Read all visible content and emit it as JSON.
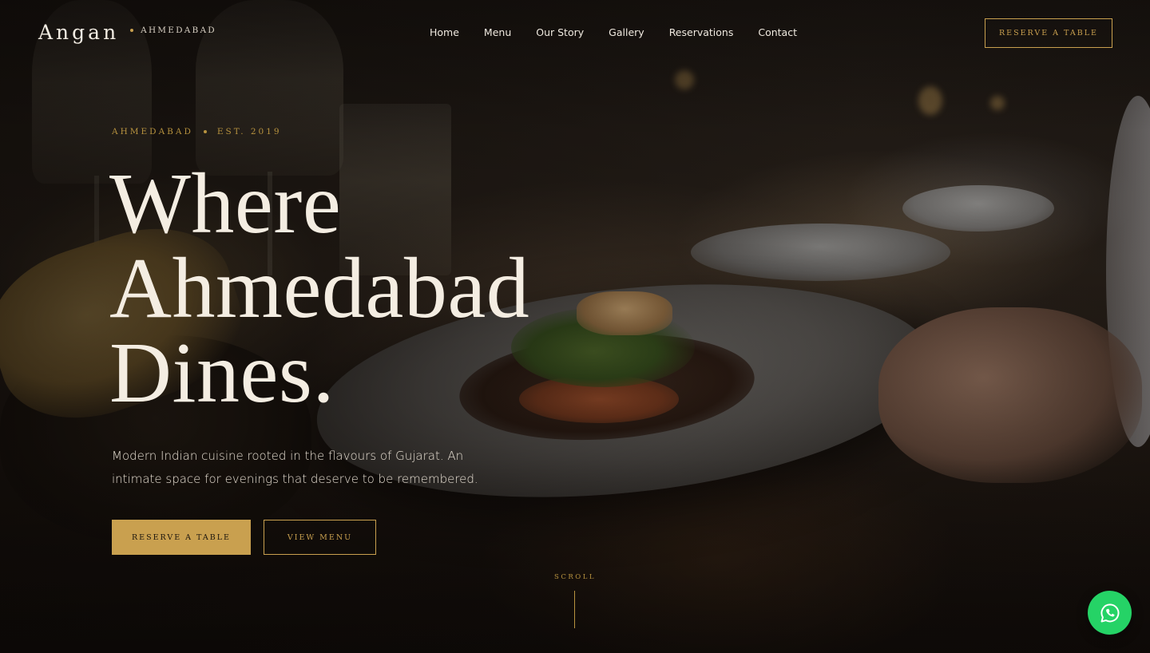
{
  "brand": {
    "name": "Angan",
    "city": "AHMEDABAD"
  },
  "nav": {
    "items": [
      {
        "label": "Home"
      },
      {
        "label": "Menu"
      },
      {
        "label": "Our Story"
      },
      {
        "label": "Gallery"
      },
      {
        "label": "Reservations"
      },
      {
        "label": "Contact"
      }
    ],
    "cta_label": "RESERVE A TABLE"
  },
  "hero": {
    "eyebrow_city": "AHMEDABAD",
    "eyebrow_est": "EST. 2019",
    "headline_lines": [
      "Where",
      "Ahmedabad",
      "Dines."
    ],
    "subtitle": "Modern Indian cuisine rooted in the flavours of Gujarat. An intimate space for evenings that deserve to be remembered.",
    "primary_cta": "RESERVE A TABLE",
    "secondary_cta": "VIEW MENU",
    "scroll_label": "SCROLL"
  },
  "icons": {
    "whatsapp": "whatsapp-icon"
  },
  "colors": {
    "accent": "#c9a04f",
    "whatsapp": "#25d366",
    "text_light": "#f4ede2"
  }
}
